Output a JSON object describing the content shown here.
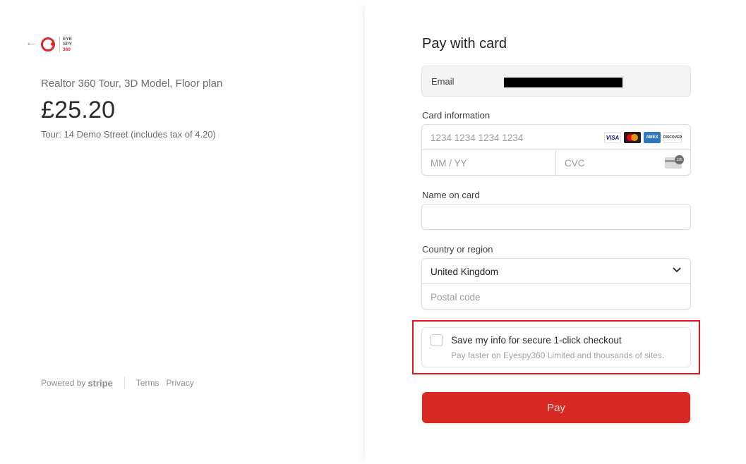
{
  "left": {
    "back_icon": "arrow-left-icon",
    "logo_lines": [
      "EYE",
      "SPY",
      "360"
    ],
    "product_name": "Realtor 360 Tour, 3D Model, Floor plan",
    "price": "£25.20",
    "price_subtitle": "Tour: 14 Demo Street (includes tax of 4.20)",
    "footer": {
      "powered_by": "Powered by",
      "brand": "stripe",
      "terms": "Terms",
      "privacy": "Privacy"
    }
  },
  "payment": {
    "title": "Pay with card",
    "email_label": "Email",
    "card_info_label": "Card information",
    "card_number_placeholder": "1234 1234 1234 1234",
    "card_brands": [
      "VISA",
      "Mastercard",
      "AMEX",
      "DISCOVER"
    ],
    "expiry_placeholder": "MM / YY",
    "cvc_placeholder": "CVC",
    "name_label": "Name on card",
    "name_value": "",
    "country_label": "Country or region",
    "country_value": "United Kingdom",
    "postal_placeholder": "Postal code",
    "save_title": "Save my info for secure 1-click checkout",
    "save_subtitle": "Pay faster on Eyespy360 Limited and thousands of sites.",
    "save_checked": false,
    "pay_button": "Pay"
  },
  "colors": {
    "brand_red": "#d92924",
    "highlight": "#e0161c"
  }
}
